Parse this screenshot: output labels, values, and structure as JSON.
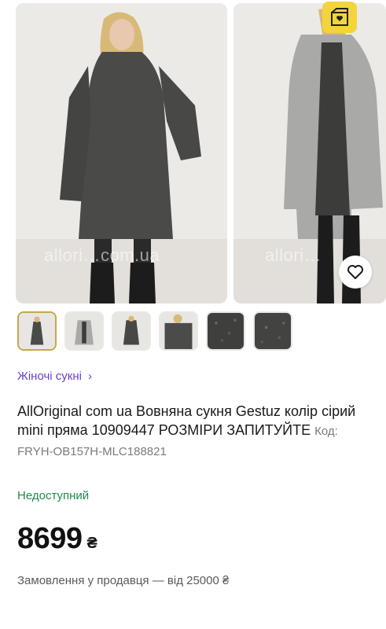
{
  "gallery": {
    "watermark_1": "allori…com.ua",
    "watermark_2": "allori…"
  },
  "icons": {
    "brand_badge": "box-heart-icon",
    "favorite": "heart-outline-icon"
  },
  "colors": {
    "accent": "#6b3fd0",
    "status_green": "#1f8a4c",
    "badge_yellow": "#f3d53a",
    "thumb_active_border": "#c8a64a"
  },
  "breadcrumb": {
    "label": "Жіночі сукні",
    "chevron": "›"
  },
  "product": {
    "title": "AllOriginal com ua Вовняна сукня Gestuz колір сірий mini пряма 10909447 РОЗМІРИ ЗАПИТУЙТЕ",
    "code": "Код: FRYH-OB157H-MLC188821",
    "availability": "Недоступний",
    "price": "8699",
    "currency": "₴",
    "seller_note": "Замовлення у продавця — від 25000 ₴"
  }
}
